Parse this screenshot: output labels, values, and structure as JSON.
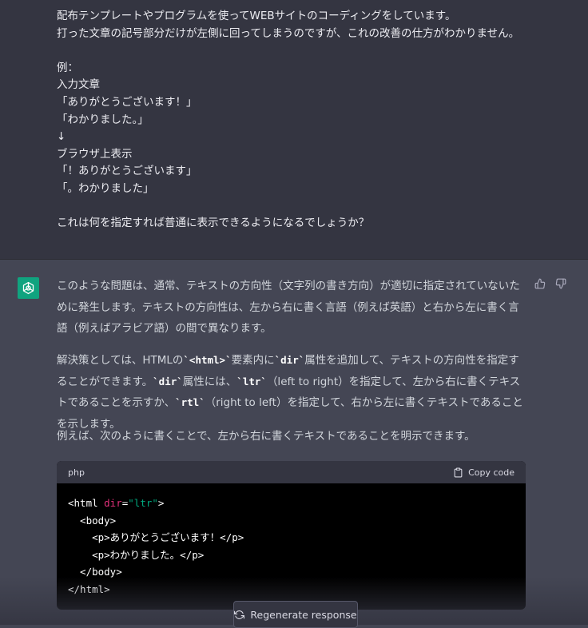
{
  "user_message": {
    "lines": [
      "配布テンプレートやプログラムを使ってWEBサイトのコーディングをしています。",
      "打った文章の記号部分だけが左側に回ってしまうのですが、これの改善の仕方がわかりません。",
      "",
      "例：",
      "入力文章",
      "「ありがとうございます！」",
      "「わかりました。」",
      "↓",
      "ブラウザ上表示",
      "「！ありがとうございます」",
      "「。わかりました」",
      "",
      "これは何を指定すれば普通に表示できるようになるでしょうか？"
    ]
  },
  "assistant": {
    "avatar_icon": "openai-logo-icon",
    "avatar_color": "#10a37f",
    "p1": "このような問題は、通常、テキストの方向性（文字列の書き方向）が適切に指定されていないために発生します。テキストの方向性は、左から右に書く言語（例えば英語）と右から左に書く言語（例えばアラビア語）の間で異なります。",
    "p2": {
      "t1": "解決策としては、HTMLの",
      "c1": "`<html>`",
      "t2": "要素内に",
      "c2": "`dir`",
      "t3": "属性を追加して、テキストの方向性を指定することができます。",
      "c3": "`dir`",
      "t4": "属性には、",
      "c4": "`ltr`",
      "t5": "（left to right）を指定して、左から右に書くテキストであることを示すか、",
      "c5": "`rtl`",
      "t6": "（right to left）を指定して、右から左に書くテキストであることを示します。"
    },
    "p3": "例えば、次のように書くことで、左から右に書くテキストであることを明示できます。",
    "code": {
      "language": "php",
      "copy_label": "Copy code",
      "line1_open": "<html ",
      "line1_attr": "dir",
      "line1_eq": "=",
      "line1_str": "\"ltr\"",
      "line1_close": ">",
      "line2": "  <body>",
      "line3": "    <p>ありがとうございます！</p>",
      "line4": "    <p>わかりました。</p>",
      "line5": "  </body>",
      "line6": "</html>"
    }
  },
  "regenerate_label": "Regenerate response",
  "colors": {
    "user_bg": "#343541",
    "assistant_bg": "#444654",
    "accent": "#10a37f"
  }
}
